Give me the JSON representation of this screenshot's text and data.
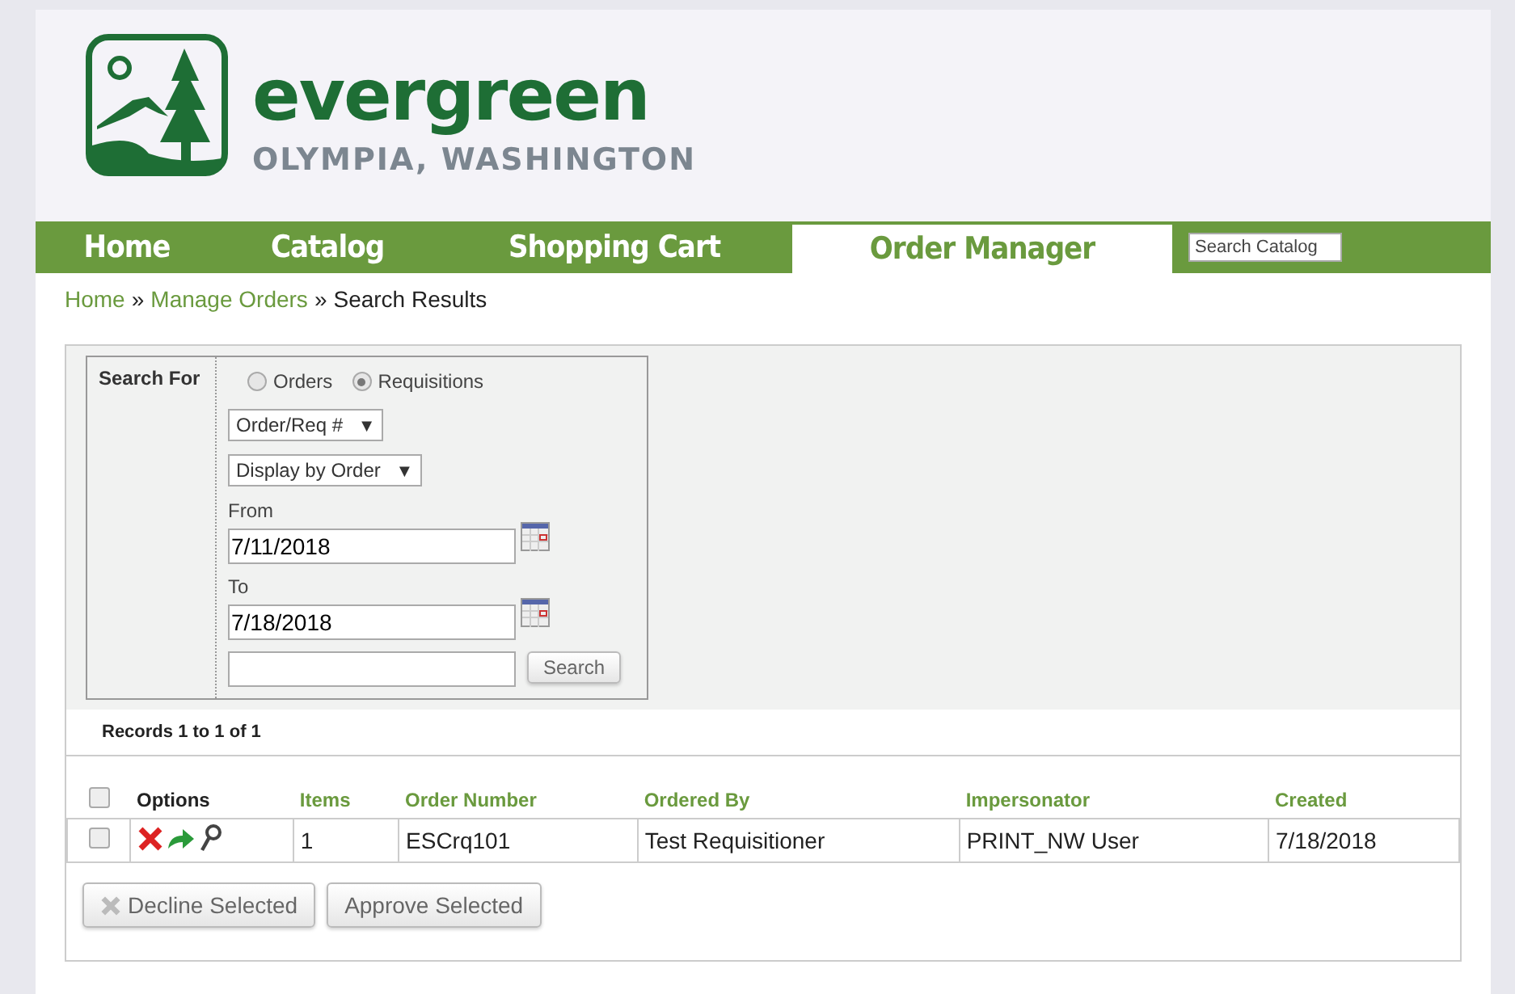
{
  "brand": {
    "name": "evergreen",
    "tagline": "OLYMPIA, WASHINGTON"
  },
  "nav": {
    "tabs": [
      {
        "label": "Home",
        "selected": false
      },
      {
        "label": "Catalog",
        "selected": false
      },
      {
        "label": "Shopping Cart",
        "selected": false
      },
      {
        "label": "Order Manager",
        "selected": true
      }
    ],
    "search": {
      "placeholder": "Search Catalog"
    }
  },
  "breadcrumb": [
    {
      "label": "Home",
      "link": true
    },
    {
      "label": "Manage Orders",
      "link": true
    },
    {
      "label": "Search Results",
      "link": false
    }
  ],
  "breadcrumb_separator": "»",
  "search_form": {
    "title": "Search For",
    "types": [
      {
        "label": "Orders",
        "selected": false
      },
      {
        "label": "Requisitions",
        "selected": true
      }
    ],
    "field_select": "Order/Req #",
    "display_select": "Display by Order",
    "select_caret": "▼",
    "from_label": "From",
    "from_value": "7/11/2018",
    "to_label": "To",
    "to_value": "7/18/2018",
    "search_button": "Search"
  },
  "records": "Records 1 to 1 of 1",
  "table": {
    "select_all_checked": false,
    "columns": [
      "Options",
      "Items",
      "Order Number",
      "Ordered By",
      "Impersonator",
      "Created"
    ],
    "rows": [
      {
        "checked": false,
        "items": "1",
        "order_number": "ESCrq101",
        "ordered_by": "Test Requisitioner",
        "impersonator": "PRINT_NW User",
        "created": "7/18/2018"
      }
    ]
  },
  "buttons": [
    {
      "label": "Decline Selected",
      "kind": "decline"
    },
    {
      "label": "Approve Selected",
      "kind": "approve"
    }
  ]
}
